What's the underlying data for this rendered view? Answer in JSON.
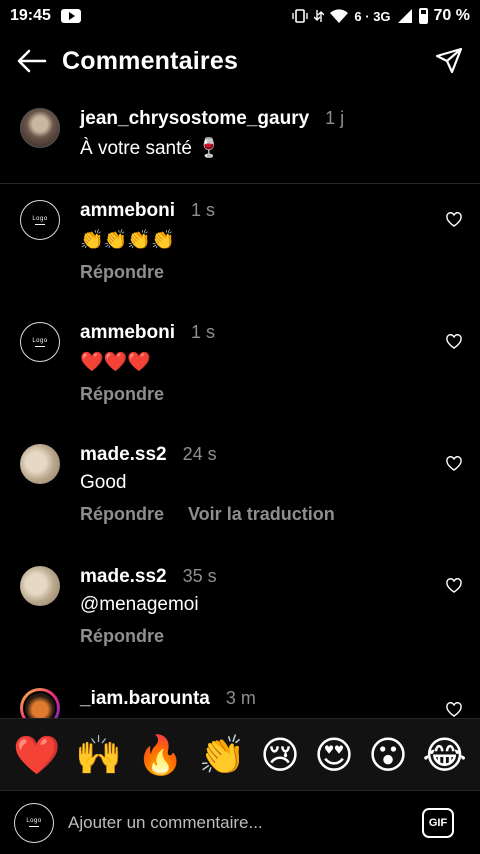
{
  "status": {
    "time": "19:45",
    "signal": "6 · 3G",
    "battery": "70 %"
  },
  "header": {
    "title": "Commentaires"
  },
  "caption": {
    "username": "jean_chrysostome_gaury",
    "time": "1 j",
    "text": "À votre santé 🍷"
  },
  "comments": [
    {
      "username": "ammeboni",
      "time": "1 s",
      "text": "👏👏👏👏",
      "reply": "Répondre"
    },
    {
      "username": "ammeboni",
      "time": "1 s",
      "text": "❤️❤️❤️",
      "reply": "Répondre"
    },
    {
      "username": "made.ss2",
      "time": "24 s",
      "text": "Good",
      "reply": "Répondre",
      "translate": "Voir la traduction"
    },
    {
      "username": "made.ss2",
      "time": "35 s",
      "text": "@menagemoi",
      "reply": "Répondre"
    },
    {
      "username": "_iam.barounta",
      "time": "3 m"
    }
  ],
  "avatar_logo_text": "Logo",
  "emojis": [
    "❤️",
    "🙌",
    "🔥",
    "👏",
    "😢",
    "😍",
    "😮",
    "😂"
  ],
  "composer": {
    "placeholder": "Ajouter un commentaire...",
    "gif_label": "GIF"
  }
}
